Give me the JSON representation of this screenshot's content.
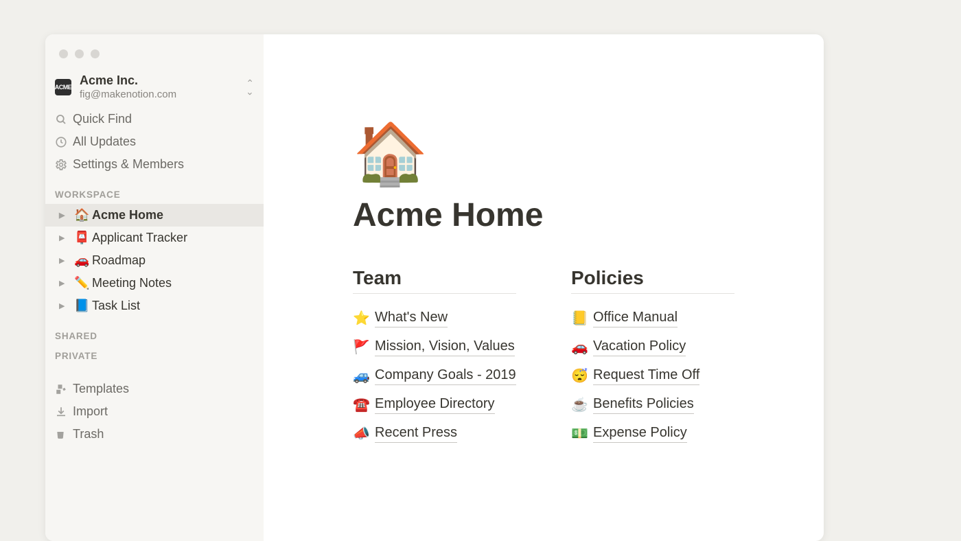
{
  "workspace": {
    "name": "Acme Inc.",
    "email": "fig@makenotion.com"
  },
  "sidebar": {
    "quick_find": "Quick Find",
    "all_updates": "All Updates",
    "settings": "Settings & Members",
    "sections": {
      "workspace": "WORKSPACE",
      "shared": "SHARED",
      "private": "PRIVATE"
    },
    "pages": [
      {
        "emoji": "🏠",
        "label": "Acme Home",
        "active": true
      },
      {
        "emoji": "📮",
        "label": "Applicant Tracker",
        "active": false
      },
      {
        "emoji": "🚗",
        "label": "Roadmap",
        "active": false
      },
      {
        "emoji": "✏️",
        "label": "Meeting Notes",
        "active": false
      },
      {
        "emoji": "📘",
        "label": "Task List",
        "active": false
      }
    ],
    "footer": {
      "templates": "Templates",
      "import": "Import",
      "trash": "Trash"
    }
  },
  "page": {
    "icon": "🏠",
    "title": "Acme Home",
    "columns": [
      {
        "heading": "Team",
        "links": [
          {
            "emoji": "⭐",
            "text": "What's New"
          },
          {
            "emoji": "🚩",
            "text": "Mission, Vision, Values"
          },
          {
            "emoji": "🚙",
            "text": "Company Goals - 2019"
          },
          {
            "emoji": "☎️",
            "text": "Employee Directory"
          },
          {
            "emoji": "📣",
            "text": "Recent Press"
          }
        ]
      },
      {
        "heading": "Policies",
        "links": [
          {
            "emoji": "📒",
            "text": "Office Manual"
          },
          {
            "emoji": "🚗",
            "text": "Vacation Policy"
          },
          {
            "emoji": "😴",
            "text": "Request Time Off"
          },
          {
            "emoji": "☕",
            "text": "Benefits Policies"
          },
          {
            "emoji": "💵",
            "text": "Expense Policy"
          }
        ]
      }
    ]
  }
}
